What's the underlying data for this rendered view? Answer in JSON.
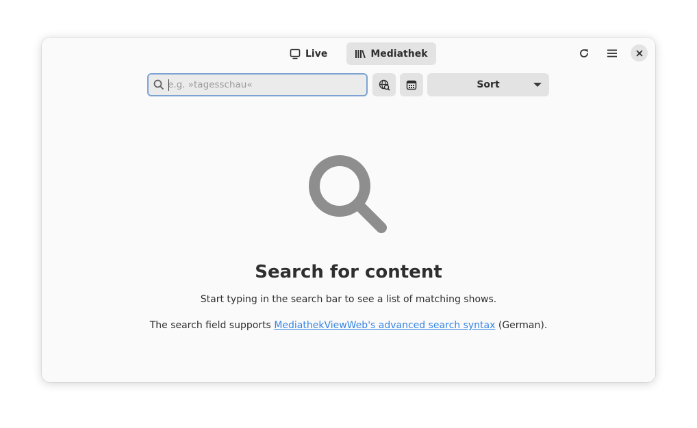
{
  "header": {
    "tabs": [
      {
        "label": "Live",
        "icon": "tv-icon",
        "active": false
      },
      {
        "label": "Mediathek",
        "icon": "library-icon",
        "active": true
      }
    ],
    "refresh_icon": "refresh-icon",
    "menu_icon": "hamburger-menu-icon",
    "close_icon": "close-icon"
  },
  "toolbar": {
    "search": {
      "placeholder": "e.g. »tagesschau«",
      "value": ""
    },
    "sort_label": "Sort"
  },
  "status": {
    "title": "Search for content",
    "description": "Start typing in the search bar to see a list of matching shows.",
    "hint_prefix": "The search field supports ",
    "hint_link": "MediathekViewWeb's advanced search syntax",
    "hint_suffix": " (German)."
  },
  "colors": {
    "link": "#3584e4",
    "focus_border": "#7da3d3",
    "window_bg": "#fafafa"
  }
}
